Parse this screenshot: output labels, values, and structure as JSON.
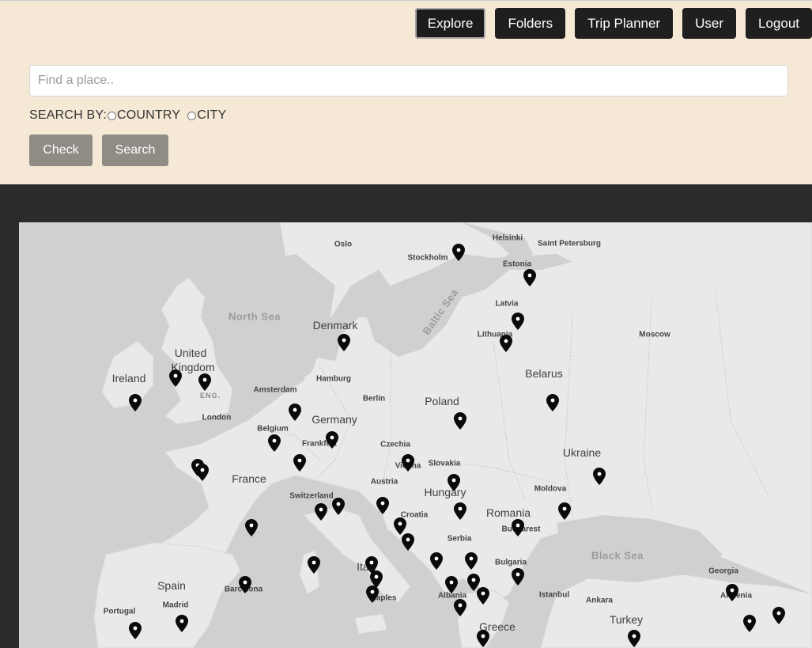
{
  "nav": {
    "items": [
      {
        "label": "Explore",
        "active": true
      },
      {
        "label": "Folders",
        "active": false
      },
      {
        "label": "Trip Planner",
        "active": false
      },
      {
        "label": "User",
        "active": false
      },
      {
        "label": "Logout",
        "active": false
      }
    ]
  },
  "search": {
    "placeholder": "Find a place..",
    "value": "",
    "search_by_label": "SEARCH BY:",
    "options": [
      "COUNTRY",
      "CITY"
    ],
    "check_label": "Check",
    "search_label": "Search"
  },
  "colors": {
    "header_bg": "#f5e9d5",
    "nav_btn_bg": "#1f1f1f",
    "action_btn_bg": "#8e8c84",
    "map_land": "#e9e9e9",
    "map_water": "#d0d0d0",
    "page_dark": "#2b2b2b"
  },
  "map": {
    "labels": [
      {
        "text": "Oslo",
        "kind": "city"
      },
      {
        "text": "Stockholm",
        "kind": "city"
      },
      {
        "text": "Helsinki",
        "kind": "city"
      },
      {
        "text": "Saint Petersburg",
        "kind": "city"
      },
      {
        "text": "Estonia",
        "kind": "country"
      },
      {
        "text": "North Sea",
        "kind": "sea"
      },
      {
        "text": "Denmark",
        "kind": "country"
      },
      {
        "text": "Baltic Sea",
        "kind": "sea"
      },
      {
        "text": "Latvia",
        "kind": "country"
      },
      {
        "text": "Lithuania",
        "kind": "country"
      },
      {
        "text": "Moscow",
        "kind": "city"
      },
      {
        "text": "United",
        "kind": "country"
      },
      {
        "text": "Kingdom",
        "kind": "country"
      },
      {
        "text": "Ireland",
        "kind": "country"
      },
      {
        "text": "ENG.",
        "kind": "region"
      },
      {
        "text": "Belarus",
        "kind": "country"
      },
      {
        "text": "Amsterdam",
        "kind": "city"
      },
      {
        "text": "Hamburg",
        "kind": "city"
      },
      {
        "text": "Berlin",
        "kind": "city"
      },
      {
        "text": "Poland",
        "kind": "country"
      },
      {
        "text": "London",
        "kind": "city"
      },
      {
        "text": "Germany",
        "kind": "country"
      },
      {
        "text": "Belgium",
        "kind": "city"
      },
      {
        "text": "Frankfurt",
        "kind": "city"
      },
      {
        "text": "Czechia",
        "kind": "city"
      },
      {
        "text": "Ukraine",
        "kind": "country"
      },
      {
        "text": "Slovakia",
        "kind": "city"
      },
      {
        "text": "Vienna",
        "kind": "city"
      },
      {
        "text": "France",
        "kind": "country"
      },
      {
        "text": "Austria",
        "kind": "city"
      },
      {
        "text": "Moldova",
        "kind": "city"
      },
      {
        "text": "Switzerland",
        "kind": "city"
      },
      {
        "text": "Hungary",
        "kind": "country"
      },
      {
        "text": "Croatia",
        "kind": "city"
      },
      {
        "text": "Romania",
        "kind": "country"
      },
      {
        "text": "Bucharest",
        "kind": "city"
      },
      {
        "text": "Serbia",
        "kind": "city"
      },
      {
        "text": "Black Sea",
        "kind": "sea"
      },
      {
        "text": "Italy",
        "kind": "country"
      },
      {
        "text": "Bulgaria",
        "kind": "city"
      },
      {
        "text": "Georgia",
        "kind": "city"
      },
      {
        "text": "Spain",
        "kind": "country"
      },
      {
        "text": "Barcelona",
        "kind": "city"
      },
      {
        "text": "Albania",
        "kind": "city"
      },
      {
        "text": "Istanbul",
        "kind": "city"
      },
      {
        "text": "Ankara",
        "kind": "city"
      },
      {
        "text": "Armenia",
        "kind": "city"
      },
      {
        "text": "Madrid",
        "kind": "city"
      },
      {
        "text": "Naples",
        "kind": "city"
      },
      {
        "text": "Portugal",
        "kind": "city"
      },
      {
        "text": "Turkey",
        "kind": "country"
      },
      {
        "text": "Greece",
        "kind": "country"
      }
    ]
  }
}
